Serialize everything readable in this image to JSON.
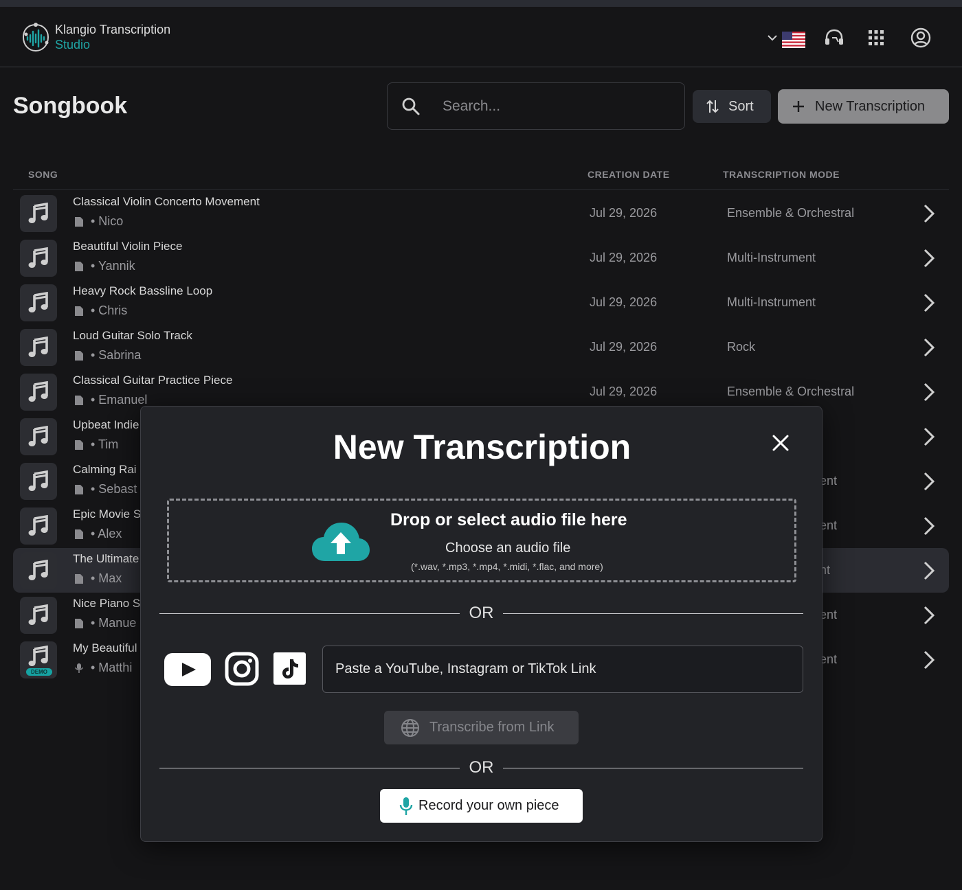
{
  "app": {
    "name_line1": "Klangio Transcription",
    "name_line2": "Studio",
    "accent": "#1fa5a5"
  },
  "header_icons": [
    "chevron-down-icon",
    "us-flag-icon",
    "headset-support-icon",
    "apps-grid-icon",
    "account-icon"
  ],
  "page": {
    "title": "Songbook"
  },
  "search": {
    "placeholder": "Search..."
  },
  "toolbar": {
    "sort_label": "Sort",
    "new_label": "New Transcription"
  },
  "table": {
    "headers": {
      "song": "SONG",
      "date": "CREATION DATE",
      "mode": "TRANSCRIPTION MODE"
    },
    "rows": [
      {
        "title": "Classical Violin Concerto Movement",
        "author": "• Nico",
        "date": "Jul 29, 2026",
        "mode": "Ensemble & Orchestral"
      },
      {
        "title": "Beautiful Violin Piece",
        "author": "• Yannik",
        "date": "Jul 29, 2026",
        "mode": "Multi-Instrument"
      },
      {
        "title": "Heavy Rock Bassline Loop",
        "author": "• Chris",
        "date": "Jul 29, 2026",
        "mode": "Multi-Instrument"
      },
      {
        "title": "Loud Guitar Solo Track",
        "author": "• Sabrina",
        "date": "Jul 29, 2026",
        "mode": "Rock"
      },
      {
        "title": "Classical Guitar Practice Piece",
        "author": "• Emanuel",
        "date": "Jul 29, 2026",
        "mode": "Ensemble & Orchestral"
      },
      {
        "title": "Upbeat Indie",
        "author": "• Tim",
        "date": "",
        "mode": ""
      },
      {
        "title": "Calming Rai",
        "author": "• Sebast",
        "date": "",
        "mode": "ent"
      },
      {
        "title": "Epic Movie S",
        "author": "• Alex",
        "date": "",
        "mode": "ent"
      },
      {
        "title": "The Ultimate",
        "author": "• Max",
        "date": "",
        "mode": "nt"
      },
      {
        "title": "Nice Piano S",
        "author": "• Manue",
        "date": "",
        "mode": "ent"
      },
      {
        "title": "My Beautiful",
        "author": "• Matthi",
        "date": "",
        "mode": "ent"
      }
    ],
    "demo_badge": "DEMO"
  },
  "modal": {
    "title": "New Transcription",
    "drop_title": "Drop or select audio file here",
    "drop_sub": "Choose an audio file",
    "drop_hint": "(*.wav, *.mp3, *.mp4, *.midi, *.flac, and more)",
    "or1": "OR",
    "or2": "OR",
    "link_placeholder": "Paste a YouTube, Instagram or TikTok Link",
    "transcribe_link_label": "Transcribe from Link",
    "record_label": "Record your own piece"
  }
}
